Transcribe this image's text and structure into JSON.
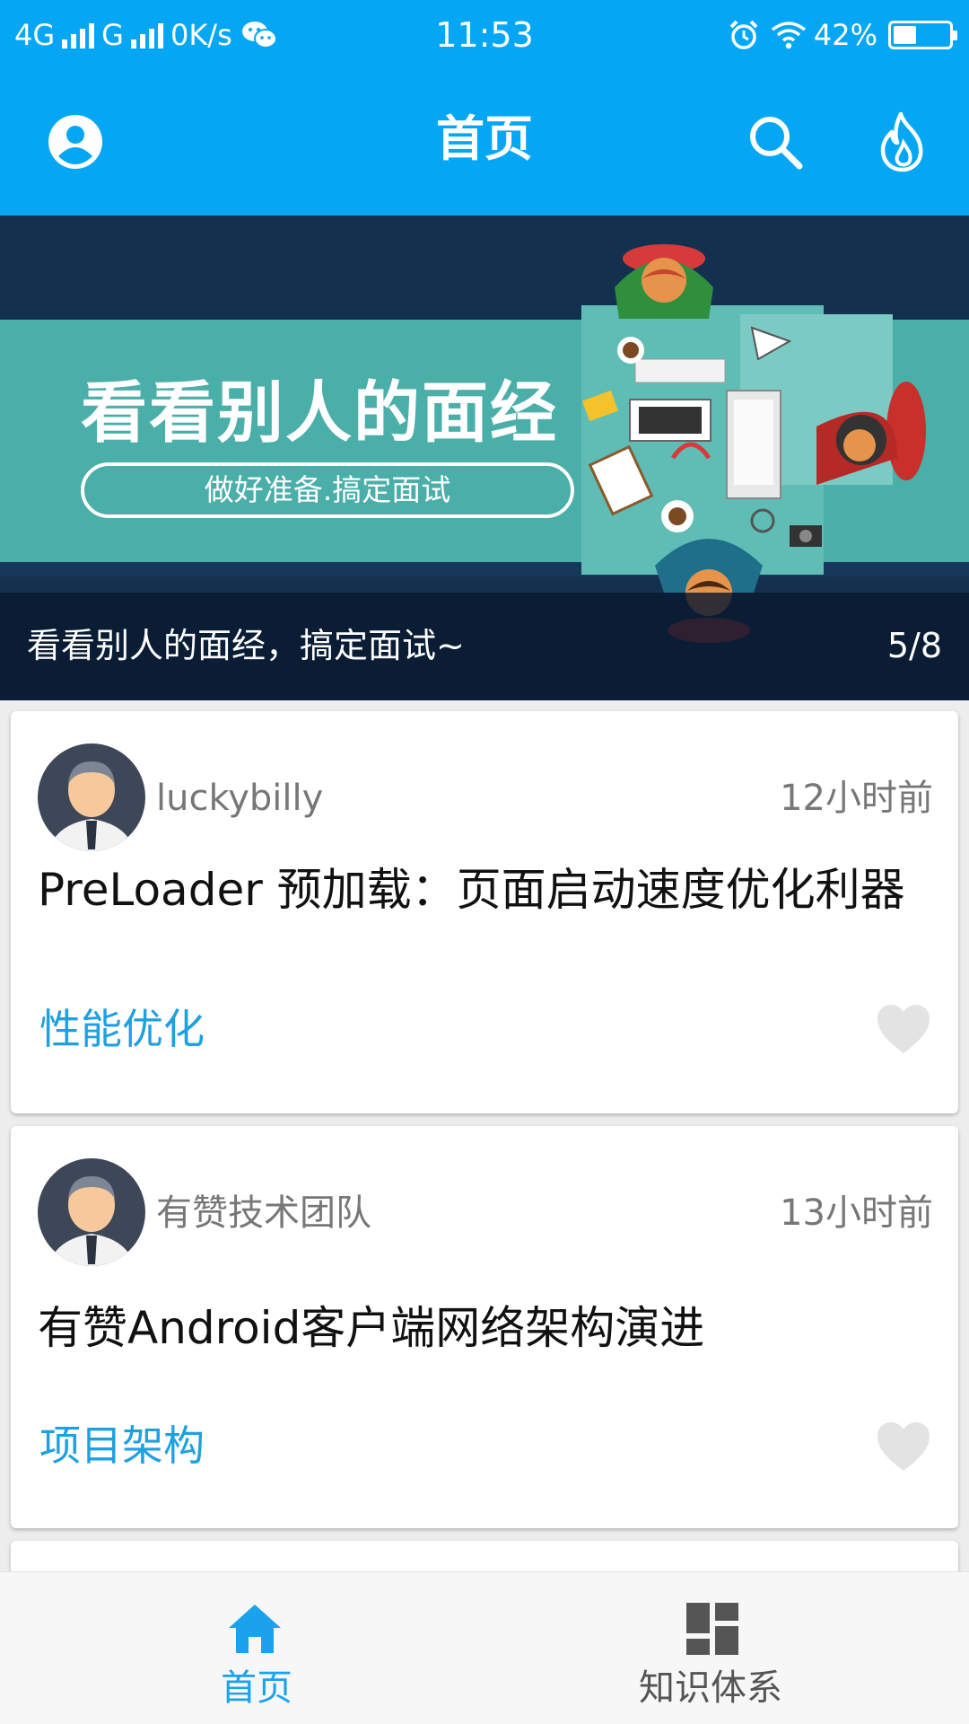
{
  "status_bar": {
    "network1": "4G",
    "network2": "G",
    "speed": "0K/s",
    "time": "11:53",
    "battery": "42%",
    "battery_level": 0.42
  },
  "toolbar": {
    "title": "首页",
    "icons": [
      "account-icon",
      "search-icon",
      "fire-icon"
    ]
  },
  "banner": {
    "headline": "看看别人的面经",
    "subline": "做好准备.搞定面试",
    "caption": "看看别人的面经，搞定面试~",
    "counter": "5/8"
  },
  "articles": [
    {
      "author": "luckybilly",
      "time": "12小时前",
      "title": "PreLoader 预加载：页面启动速度优化利器",
      "tag": "性能优化"
    },
    {
      "author": "有赞技术团队",
      "time": "13小时前",
      "title": "有赞Android客户端网络架构演进",
      "tag": "项目架构"
    }
  ],
  "bottom_nav": {
    "home_label": "首页",
    "system_label": "知识体系"
  },
  "colors": {
    "primary": "#05a7f4",
    "tag": "#1fa0e0",
    "nav_active": "#1aa3ec",
    "nav_inactive": "#555555"
  }
}
